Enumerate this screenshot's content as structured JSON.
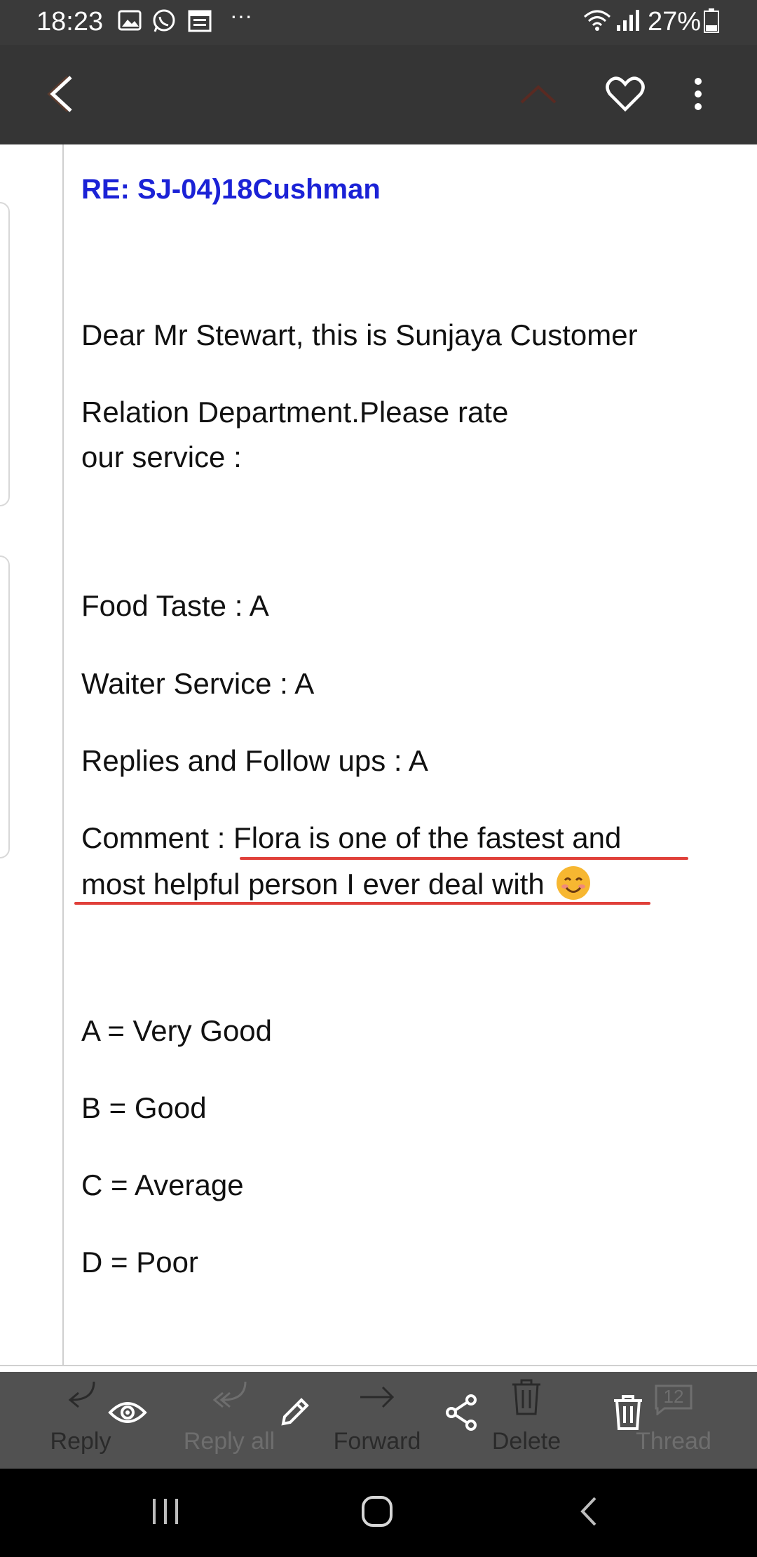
{
  "status_bar": {
    "time": "18:23",
    "battery": "27%",
    "icons": [
      "gallery-icon",
      "whatsapp-icon",
      "calendar-icon",
      "more-notifications-icon",
      "wifi-icon",
      "signal-icon",
      "battery-icon"
    ],
    "more": "···"
  },
  "app_bar": {
    "icons": [
      "back-icon",
      "chevron-up-icon",
      "heart-icon",
      "more-vert-icon"
    ]
  },
  "email": {
    "subject": "RE: SJ-04)18Cushman",
    "body": {
      "greeting": "Dear Mr Stewart, this is Sunjaya Customer",
      "line2": "Relation Department.Please rate",
      "line3": "our service :",
      "food": "Food Taste : A",
      "waiter": "Waiter Service : A",
      "replies": "Replies and Follow ups : A",
      "comment_line1": "Comment : Flora is one of the fastest and",
      "comment_line2": "most helpful person I ever deal with",
      "emoji": "smiling-face-emoji",
      "legend_a": "A = Very Good",
      "legend_b": "B = Good",
      "legend_c": "C = Average",
      "legend_d": "D = Poor"
    },
    "underline_color": "#e0403a",
    "subject_color": "#1b22d6"
  },
  "toolbar": {
    "reply": "Reply",
    "reply_all": "Reply all",
    "forward": "Forward",
    "delete": "Delete",
    "thread": "Thread",
    "thread_count": "12",
    "overlay_icons": [
      "eye-icon",
      "pencil-icon",
      "share-icon",
      "trash-icon"
    ]
  },
  "nav_bar": {
    "icons": [
      "recent-apps-icon",
      "home-icon",
      "nav-back-icon"
    ]
  }
}
